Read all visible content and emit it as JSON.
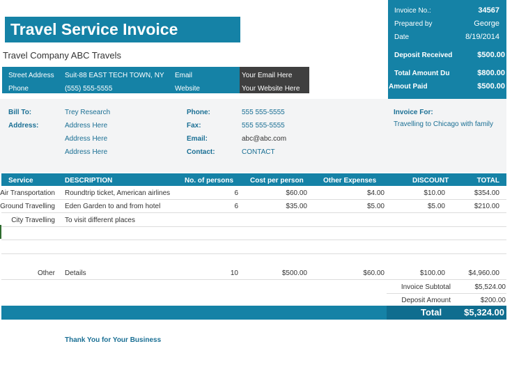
{
  "header": {
    "title": "Travel Service Invoice",
    "company": "Travel Company ABC Travels"
  },
  "contact_bar": {
    "street_label": "Street Address",
    "street_value": "Suit-88 EAST TECH TOWN, NY",
    "phone_label": "Phone",
    "phone_value": "(555) 555-5555",
    "email_label": "Email",
    "email_value": "Your Email Here",
    "website_label": "Website",
    "website_value": "Your Website Here"
  },
  "summary": {
    "invoice_no_label": "Invoice No.:",
    "invoice_no": "34567",
    "prepared_by_label": "Prepared by",
    "prepared_by": "George",
    "date_label": "Date",
    "date": "8/19/2014",
    "deposit_label": "Deposit Received",
    "deposit": "$500.00",
    "total_due_label": "Total Amount Du",
    "total_due": "$800.00",
    "paid_label": "Amout Paid",
    "paid": "$500.00"
  },
  "bill_to": {
    "bill_to_label": "Bill To:",
    "name": "Trey Research",
    "address_label": "Address:",
    "address_lines": [
      "Address Here",
      "Address Here",
      "Address Here"
    ],
    "phone_label": "Phone:",
    "phone": "555 555-5555",
    "fax_label": "Fax:",
    "fax": "555 555-5555",
    "email_label": "Email:",
    "email": "abc@abc.com",
    "contact_label": "Contact:",
    "contact": "CONTACT",
    "invoice_for_label": "Invoice For:",
    "invoice_for": "Travelling to Chicago with family"
  },
  "table": {
    "columns": [
      "Service",
      "DESCRIPTION",
      "No. of persons",
      "Cost per person",
      "Other Expenses",
      "DISCOUNT",
      "TOTAL"
    ],
    "rows": [
      {
        "service": "Air Transportation",
        "description": "Roundtrip ticket, American airlines",
        "persons": "6",
        "cost": "$60.00",
        "other": "$4.00",
        "discount": "$10.00",
        "total": "$354.00"
      },
      {
        "service": "Ground Travelling",
        "description": "Eden Garden to and from hotel",
        "persons": "6",
        "cost": "$35.00",
        "other": "$5.00",
        "discount": "$5.00",
        "total": "$210.00"
      },
      {
        "service": "City Travelling",
        "description": "To visit different places",
        "persons": "",
        "cost": "",
        "other": "",
        "discount": "",
        "total": ""
      },
      {
        "service": "",
        "description": "",
        "persons": "",
        "cost": "",
        "other": "",
        "discount": "",
        "total": ""
      },
      {
        "service": "",
        "description": "",
        "persons": "",
        "cost": "",
        "other": "",
        "discount": "",
        "total": ""
      },
      {
        "service": "Other",
        "description": "Details",
        "persons": "10",
        "cost": "$500.00",
        "other": "$60.00",
        "discount": "$100.00",
        "total": "$4,960.00"
      }
    ]
  },
  "totals": {
    "subtotal_label": "Invoice Subtotal",
    "subtotal": "$5,524.00",
    "deposit_label": "Deposit Amount",
    "deposit": "$200.00",
    "total_label": "Total",
    "total": "$5,324.00"
  },
  "footer": {
    "thanks": "Thank You for Your Business"
  }
}
